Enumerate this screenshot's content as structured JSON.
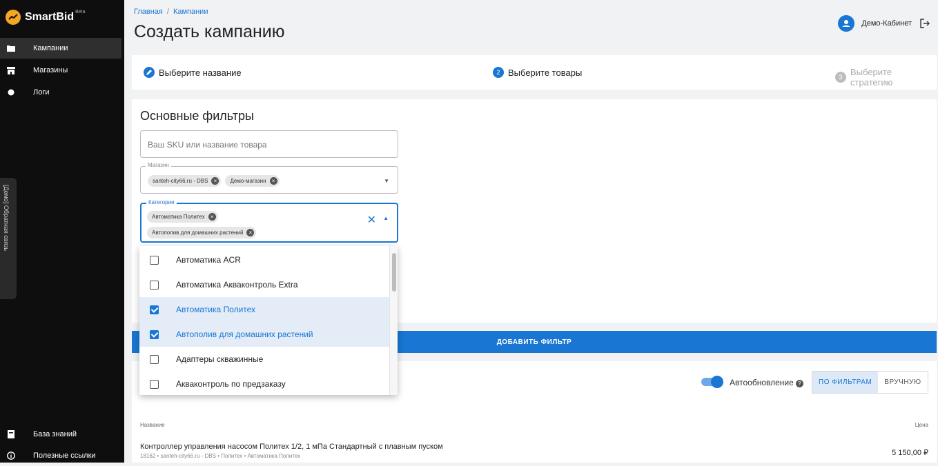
{
  "app": {
    "name": "SmartBid",
    "badge": "Beta"
  },
  "sidebar": {
    "items": [
      {
        "label": "Кампании",
        "icon": "folder-icon"
      },
      {
        "label": "Магазины",
        "icon": "store-icon"
      },
      {
        "label": "Логи",
        "icon": "dot-icon"
      }
    ],
    "bottom": [
      {
        "label": "База знаний",
        "icon": "book-icon"
      },
      {
        "label": "Полезные ссылки",
        "icon": "info-icon"
      }
    ],
    "feedback_tab": "[Демо] Обратная связь"
  },
  "header": {
    "breadcrumb": [
      "Главная",
      "Кампании"
    ],
    "title": "Создать кампанию",
    "user": "Демо-Кабинет"
  },
  "stepper": {
    "steps": [
      {
        "label": "Выберите название",
        "number": "",
        "state": "done"
      },
      {
        "label": "Выберите товары",
        "number": "2",
        "state": "active"
      },
      {
        "label": "Выберите стратегию",
        "number": "3",
        "state": "inactive"
      }
    ]
  },
  "filters": {
    "title": "Основные фильтры",
    "search_placeholder": "Ваш SKU или название товара",
    "shop": {
      "legend": "Магазин",
      "chips": [
        "santeh-city66.ru - DBS",
        "Демо-магазин"
      ]
    },
    "category": {
      "legend": "Категории",
      "chips": [
        "Автоматика Политех",
        "Автополив для домашних растений"
      ]
    },
    "options": [
      {
        "label": "Автоматика ACR",
        "checked": false
      },
      {
        "label": "Автоматика Акваконтроль Extra",
        "checked": false
      },
      {
        "label": "Автоматика Политех",
        "checked": true
      },
      {
        "label": "Автополив для домашних растений",
        "checked": true
      },
      {
        "label": "Адаптеры скважинные",
        "checked": false
      },
      {
        "label": "Акваконтроль по предзаказу",
        "checked": false
      }
    ],
    "add_button": "ДОБАВИТЬ ФИЛЬТР"
  },
  "products": {
    "auto_update": "Автообновление",
    "auto_update_on": true,
    "modes": [
      "ПО ФИЛЬТРАМ",
      "ВРУЧНУЮ"
    ],
    "active_mode": "ПО ФИЛЬТРАМ",
    "columns": [
      "Название",
      "Цена"
    ],
    "rows": [
      {
        "title": "Контроллер управления насосом Политех 1/2, 1 мПа Стандартный с плавным пуском",
        "subtitle": "18162 • santeh-city66.ru - DBS • Политех • Автоматика Политех",
        "price": "5 150,00 ₽"
      }
    ]
  },
  "colors": {
    "accent": "#1976d2",
    "sidebar_bg": "#0e0e0e",
    "logo": "#f5a623"
  }
}
